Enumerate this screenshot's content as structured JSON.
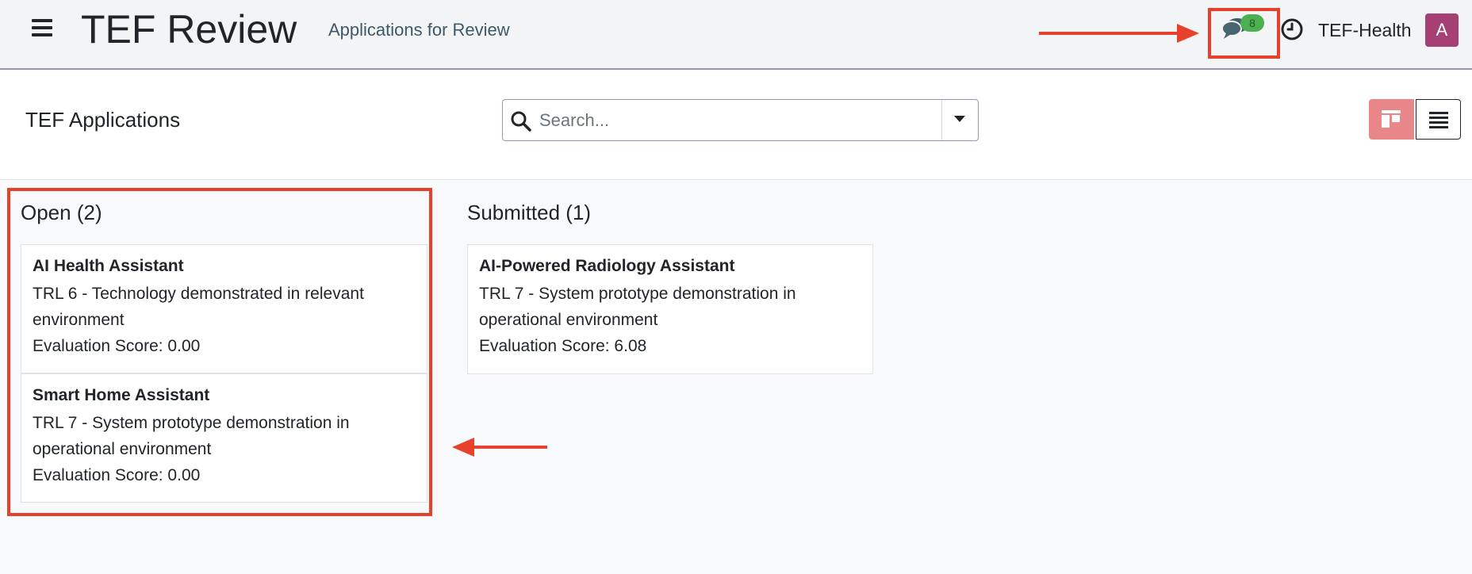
{
  "navbar": {
    "app_title": "TEF Review",
    "subtitle": "Applications for Review",
    "chat_badge": "8",
    "company": "TEF-Health",
    "avatar_initial": "A"
  },
  "control_panel": {
    "title": "TEF Applications",
    "search_placeholder": "Search...",
    "view_buttons": [
      "kanban-icon",
      "list-icon"
    ]
  },
  "columns": [
    {
      "title": "Open (2)",
      "cards": [
        {
          "title": "AI Health Assistant",
          "trl": "TRL 6 - Technology demonstrated in relevant environment",
          "score": "Evaluation Score: 0.00"
        },
        {
          "title": "Smart Home Assistant",
          "trl": "TRL 7 - System prototype demonstration in operational environment",
          "score": "Evaluation Score: 0.00"
        }
      ]
    },
    {
      "title": "Submitted (1)",
      "cards": [
        {
          "title": "AI-Powered Radiology Assistant",
          "trl": "TRL 7 - System prototype demonstration in operational environment",
          "score": "Evaluation Score: 6.08"
        }
      ]
    }
  ],
  "colors": {
    "annotation": "#e8412b",
    "avatar": "#a53f74",
    "kanban_active": "#e8868a",
    "badge": "#4caf50"
  }
}
